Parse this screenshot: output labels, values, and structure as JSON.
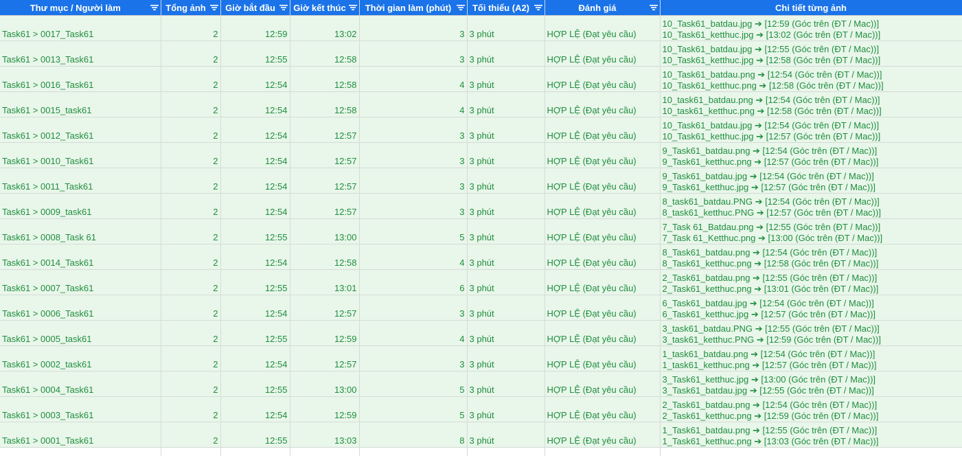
{
  "headers": [
    {
      "label": "Thư mục / Người làm"
    },
    {
      "label": "Tổng ảnh"
    },
    {
      "label": "Giờ bắt đầu"
    },
    {
      "label": "Giờ kết thúc"
    },
    {
      "label": "Thời gian làm (phút)"
    },
    {
      "label": "Tối thiểu (A2)"
    },
    {
      "label": "Đánh giá"
    },
    {
      "label": "Chi tiết từng ảnh"
    }
  ],
  "colors": {
    "header_bg": "#1a73e8",
    "row_bg": "#e9f6ea",
    "text": "#1e8e3e"
  },
  "icons": {
    "filter": "filter-icon"
  },
  "rows": [
    {
      "folder": "Task61 > 0017_Task61",
      "total": "2",
      "start": "12:59",
      "end": "13:02",
      "duration": "3",
      "min": "3 phút",
      "eval": "HỢP LỆ (Đạt yêu cầu)",
      "detail1": "10_Task61_batdau.jpg ➔ [12:59 (Góc trên (ĐT / Mac))]",
      "detail2": "10_Task61_ketthuc.jpg ➔ [13:02 (Góc trên (ĐT / Mac))]"
    },
    {
      "folder": "Task61 > 0013_Task61",
      "total": "2",
      "start": "12:55",
      "end": "12:58",
      "duration": "3",
      "min": "3 phút",
      "eval": "HỢP LỆ (Đạt yêu cầu)",
      "detail1": "10_Task61_batdau.jpg ➔ [12:55 (Góc trên (ĐT / Mac))]",
      "detail2": "10_Task61_ketthuc.jpg ➔ [12:58 (Góc trên (ĐT / Mac))]"
    },
    {
      "folder": "Task61 > 0016_Task61",
      "total": "2",
      "start": "12:54",
      "end": "12:58",
      "duration": "4",
      "min": "3 phút",
      "eval": "HỢP LỆ (Đạt yêu cầu)",
      "detail1": "10_Task61_batdau.png ➔ [12:54 (Góc trên (ĐT / Mac))]",
      "detail2": "10_Task61_ketthuc.png ➔ [12:58 (Góc trên (ĐT / Mac))]"
    },
    {
      "folder": "Task61 > 0015_task61",
      "total": "2",
      "start": "12:54",
      "end": "12:58",
      "duration": "4",
      "min": "3 phút",
      "eval": "HỢP LỆ (Đạt yêu cầu)",
      "detail1": "10_task61_batdau.png ➔ [12:54 (Góc trên (ĐT / Mac))]",
      "detail2": "10_task61_ketthuc.png ➔ [12:58 (Góc trên (ĐT / Mac))]"
    },
    {
      "folder": "Task61 > 0012_Task61",
      "total": "2",
      "start": "12:54",
      "end": "12:57",
      "duration": "3",
      "min": "3 phút",
      "eval": "HỢP LỆ (Đạt yêu cầu)",
      "detail1": "10_Task61_batdau.jpg ➔ [12:54 (Góc trên (ĐT / Mac))]",
      "detail2": "10_Task61_ketthuc.jpg ➔ [12:57 (Góc trên (ĐT / Mac))]"
    },
    {
      "folder": "Task61 > 0010_Task61",
      "total": "2",
      "start": "12:54",
      "end": "12:57",
      "duration": "3",
      "min": "3 phút",
      "eval": "HỢP LỆ (Đạt yêu cầu)",
      "detail1": "9_Task61_batdau.png ➔ [12:54 (Góc trên (ĐT / Mac))]",
      "detail2": "9_Task61_ketthuc.png ➔ [12:57 (Góc trên (ĐT / Mac))]"
    },
    {
      "folder": "Task61 > 0011_Task61",
      "total": "2",
      "start": "12:54",
      "end": "12:57",
      "duration": "3",
      "min": "3 phút",
      "eval": "HỢP LỆ (Đạt yêu cầu)",
      "detail1": "9_Task61_batdau.jpg ➔ [12:54 (Góc trên (ĐT / Mac))]",
      "detail2": "9_Task61_ketthuc.jpg ➔ [12:57 (Góc trên (ĐT / Mac))]"
    },
    {
      "folder": "Task61 > 0009_task61",
      "total": "2",
      "start": "12:54",
      "end": "12:57",
      "duration": "3",
      "min": "3 phút",
      "eval": "HỢP LỆ (Đạt yêu cầu)",
      "detail1": "8_task61_batdau.PNG ➔ [12:54 (Góc trên (ĐT / Mac))]",
      "detail2": "8_task61_ketthuc.PNG ➔ [12:57 (Góc trên (ĐT / Mac))]"
    },
    {
      "folder": "Task61 > 0008_Task 61",
      "total": "2",
      "start": "12:55",
      "end": "13:00",
      "duration": "5",
      "min": "3 phút",
      "eval": "HỢP LỆ (Đạt yêu cầu)",
      "detail1": "7_Task 61_Batdau.png ➔ [12:55 (Góc trên (ĐT / Mac))]",
      "detail2": "7_Task 61_Ketthuc.png ➔ [13:00 (Góc trên (ĐT / Mac))]"
    },
    {
      "folder": "Task61 > 0014_Task61",
      "total": "2",
      "start": "12:54",
      "end": "12:58",
      "duration": "4",
      "min": "3 phút",
      "eval": "HỢP LỆ (Đạt yêu cầu)",
      "detail1": "8_Task61_batdau.png ➔ [12:54 (Góc trên (ĐT / Mac))]",
      "detail2": "8_Task61_ketthuc.png ➔ [12:58 (Góc trên (ĐT / Mac))]"
    },
    {
      "folder": "Task61 > 0007_Task61",
      "total": "2",
      "start": "12:55",
      "end": "13:01",
      "duration": "6",
      "min": "3 phút",
      "eval": "HỢP LỆ (Đạt yêu cầu)",
      "detail1": "2_Task61_batdau.png ➔ [12:55 (Góc trên (ĐT / Mac))]",
      "detail2": "2_Task61_ketthuc.png ➔ [13:01 (Góc trên (ĐT / Mac))]"
    },
    {
      "folder": "Task61 > 0006_Task61",
      "total": "2",
      "start": "12:54",
      "end": "12:57",
      "duration": "3",
      "min": "3 phút",
      "eval": "HỢP LỆ (Đạt yêu cầu)",
      "detail1": "6_Task61_batdau.jpg ➔ [12:54 (Góc trên (ĐT / Mac))]",
      "detail2": "6_Task61_ketthuc.jpg ➔ [12:57 (Góc trên (ĐT / Mac))]"
    },
    {
      "folder": "Task61 > 0005_task61",
      "total": "2",
      "start": "12:55",
      "end": "12:59",
      "duration": "4",
      "min": "3 phút",
      "eval": "HỢP LỆ (Đạt yêu cầu)",
      "detail1": "3_task61_batdau.PNG ➔ [12:55 (Góc trên (ĐT / Mac))]",
      "detail2": "3_task61_ketthuc.PNG ➔ [12:59 (Góc trên (ĐT / Mac))]"
    },
    {
      "folder": "Task61 > 0002_task61",
      "total": "2",
      "start": "12:54",
      "end": "12:57",
      "duration": "3",
      "min": "3 phút",
      "eval": "HỢP LỆ (Đạt yêu cầu)",
      "detail1": "1_task61_batdau.png ➔ [12:54 (Góc trên (ĐT / Mac))]",
      "detail2": "1_task61_ketthuc.png ➔ [12:57 (Góc trên (ĐT / Mac))]"
    },
    {
      "folder": "Task61 > 0004_Task61",
      "total": "2",
      "start": "12:55",
      "end": "13:00",
      "duration": "5",
      "min": "3 phút",
      "eval": "HỢP LỆ (Đạt yêu cầu)",
      "detail1": "3_Task61_ketthuc.jpg ➔ [13:00 (Góc trên (ĐT / Mac))]",
      "detail2": "3_Task61_batdau.jpg ➔ [12:55 (Góc trên (ĐT / Mac))]"
    },
    {
      "folder": "Task61 > 0003_Task61",
      "total": "2",
      "start": "12:54",
      "end": "12:59",
      "duration": "5",
      "min": "3 phút",
      "eval": "HỢP LỆ (Đạt yêu cầu)",
      "detail1": "2_Task61_batdau.png ➔ [12:54 (Góc trên (ĐT / Mac))]",
      "detail2": "2_Task61_ketthuc.png ➔ [12:59 (Góc trên (ĐT / Mac))]"
    },
    {
      "folder": "Task61 > 0001_Task61",
      "total": "2",
      "start": "12:55",
      "end": "13:03",
      "duration": "8",
      "min": "3 phút",
      "eval": "HỢP LỆ (Đạt yêu cầu)",
      "detail1": "1_Task61_batdau.png ➔ [12:55 (Góc trên (ĐT / Mac))]",
      "detail2": "1_Task61_ketthuc.png ➔ [13:03 (Góc trên (ĐT / Mac))]"
    }
  ]
}
